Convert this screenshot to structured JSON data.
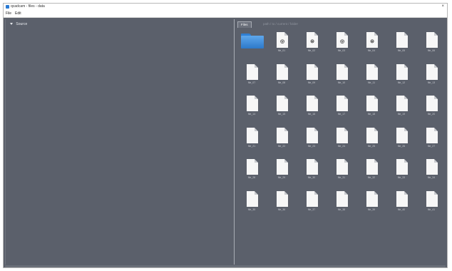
{
  "window": {
    "title": "qcadcam - files - data",
    "close_label": "×"
  },
  "menu": [
    {
      "label": "File"
    },
    {
      "label": "Edit"
    }
  ],
  "tree": {
    "root_label": "Source"
  },
  "tabs": [
    {
      "label": "Files"
    },
    {
      "label": "path / to / current / folder"
    }
  ],
  "grid": {
    "columns": 7,
    "items": [
      {
        "kind": "folder",
        "label": ""
      },
      {
        "kind": "file",
        "glyph": "◎",
        "label": "file_01"
      },
      {
        "kind": "file",
        "glyph": "⊜",
        "label": "file_02"
      },
      {
        "kind": "file",
        "glyph": "◎",
        "label": "file_03"
      },
      {
        "kind": "file",
        "glyph": "⊜",
        "label": "file_04"
      },
      {
        "kind": "file",
        "glyph": "",
        "label": "file_05"
      },
      {
        "kind": "file",
        "glyph": "",
        "label": "file_06"
      },
      {
        "kind": "file",
        "glyph": "",
        "label": "file_07"
      },
      {
        "kind": "file",
        "glyph": "",
        "label": "file_08"
      },
      {
        "kind": "file",
        "glyph": "",
        "label": "file_09"
      },
      {
        "kind": "file",
        "glyph": "",
        "label": "file_10"
      },
      {
        "kind": "file",
        "glyph": "",
        "label": "file_11"
      },
      {
        "kind": "file",
        "glyph": "",
        "label": "file_12"
      },
      {
        "kind": "file",
        "glyph": "",
        "label": "file_13"
      },
      {
        "kind": "file",
        "glyph": "",
        "label": "file_14"
      },
      {
        "kind": "file",
        "glyph": "",
        "label": "file_15"
      },
      {
        "kind": "file",
        "glyph": "",
        "label": "file_16"
      },
      {
        "kind": "file",
        "glyph": "",
        "label": "file_17"
      },
      {
        "kind": "file",
        "glyph": "",
        "label": "file_18"
      },
      {
        "kind": "file",
        "glyph": "",
        "label": "file_19"
      },
      {
        "kind": "file",
        "glyph": "",
        "label": "file_20"
      },
      {
        "kind": "file",
        "glyph": "",
        "label": "file_21"
      },
      {
        "kind": "file",
        "glyph": "",
        "label": "file_22"
      },
      {
        "kind": "file",
        "glyph": "",
        "label": "file_23"
      },
      {
        "kind": "file",
        "glyph": "",
        "label": "file_24"
      },
      {
        "kind": "file",
        "glyph": "",
        "label": "file_25"
      },
      {
        "kind": "file",
        "glyph": "",
        "label": "file_26"
      },
      {
        "kind": "file",
        "glyph": "",
        "label": "file_27"
      },
      {
        "kind": "file",
        "glyph": "",
        "label": "file_28"
      },
      {
        "kind": "file",
        "glyph": "",
        "label": "file_29"
      },
      {
        "kind": "file",
        "glyph": "",
        "label": "file_30"
      },
      {
        "kind": "file",
        "glyph": "",
        "label": "file_31"
      },
      {
        "kind": "file",
        "glyph": "",
        "label": "file_32"
      },
      {
        "kind": "file",
        "glyph": "",
        "label": "file_33"
      },
      {
        "kind": "file",
        "glyph": "",
        "label": "file_34"
      },
      {
        "kind": "file",
        "glyph": "",
        "label": "file_35"
      },
      {
        "kind": "file",
        "glyph": "",
        "label": "file_36"
      },
      {
        "kind": "file",
        "glyph": "",
        "label": "file_37"
      },
      {
        "kind": "file",
        "glyph": "",
        "label": "file_38"
      },
      {
        "kind": "file",
        "glyph": "",
        "label": "file_39"
      },
      {
        "kind": "file",
        "glyph": "",
        "label": "file_40"
      },
      {
        "kind": "file",
        "glyph": "",
        "label": "file_41"
      }
    ]
  },
  "colors": {
    "pane_bg": "#5b606b",
    "folder_blue": "#2d79c9",
    "title_icon": "#2a7bd4"
  }
}
